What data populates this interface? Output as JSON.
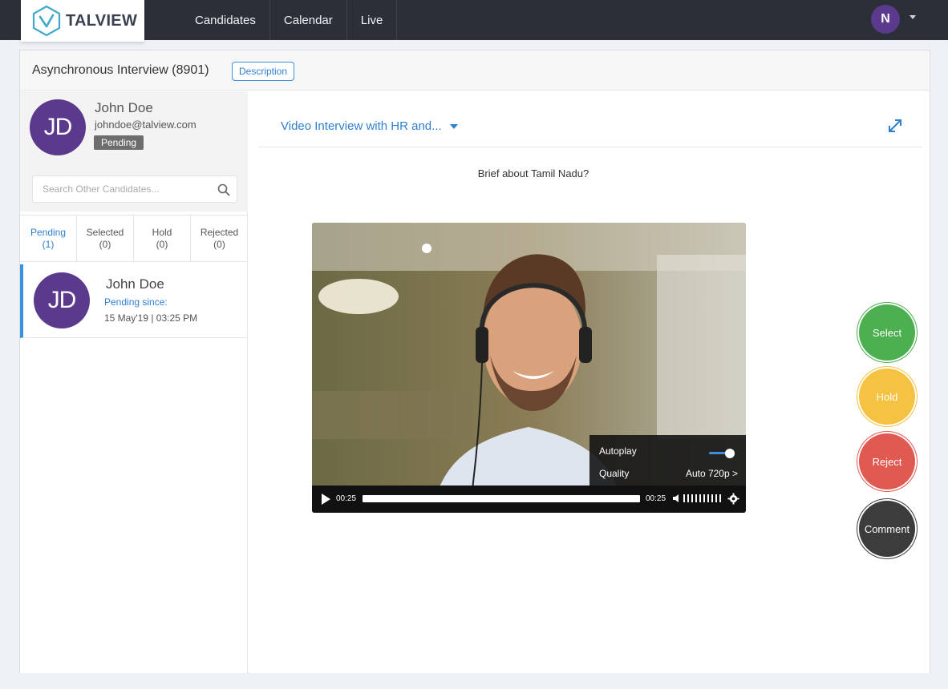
{
  "header": {
    "logo_text": "TALVIEW",
    "nav": [
      "Candidates",
      "Calendar",
      "Live"
    ],
    "user_initial": "N"
  },
  "page": {
    "title": "Asynchronous Interview (8901)",
    "description_btn": "Description"
  },
  "profile": {
    "initials": "JD",
    "name": "John Doe",
    "email": "johndoe@talview.com",
    "status": "Pending"
  },
  "search": {
    "placeholder": "Search Other Candidates..."
  },
  "tabs": [
    {
      "label": "Pending",
      "count": "(1)"
    },
    {
      "label": "Selected",
      "count": "(0)"
    },
    {
      "label": "Hold",
      "count": "(0)"
    },
    {
      "label": "Rejected",
      "count": "(0)"
    }
  ],
  "candidate_card": {
    "initials": "JD",
    "name": "John Doe",
    "status": "Pending since:",
    "date": "15 May'19 | 03:25 PM"
  },
  "interview": {
    "selector": "Video Interview with HR and...",
    "question": "Brief about Tamil Nadu?"
  },
  "video": {
    "autoplay_label": "Autoplay",
    "autoplay_on": true,
    "quality_label": "Quality",
    "quality_value": "Auto 720p >",
    "time_current": "00:25",
    "time_total": "00:25",
    "progress": 1.0
  },
  "actions": {
    "select": "Select",
    "hold": "Hold",
    "reject": "Reject",
    "comment": "Comment"
  },
  "colors": {
    "topbar": "#2b2f37",
    "accent": "#2f7fd1",
    "avatar": "#5b3a8e",
    "select": "#4caf50",
    "hold": "#f5c242",
    "reject": "#e05a52",
    "comment": "#3c3c3c"
  },
  "icons": {
    "logo": "talview-logo-icon",
    "search": "search-icon",
    "expand": "expand-icon",
    "play": "play-icon",
    "volume": "volume-icon",
    "settings": "gear-icon"
  }
}
